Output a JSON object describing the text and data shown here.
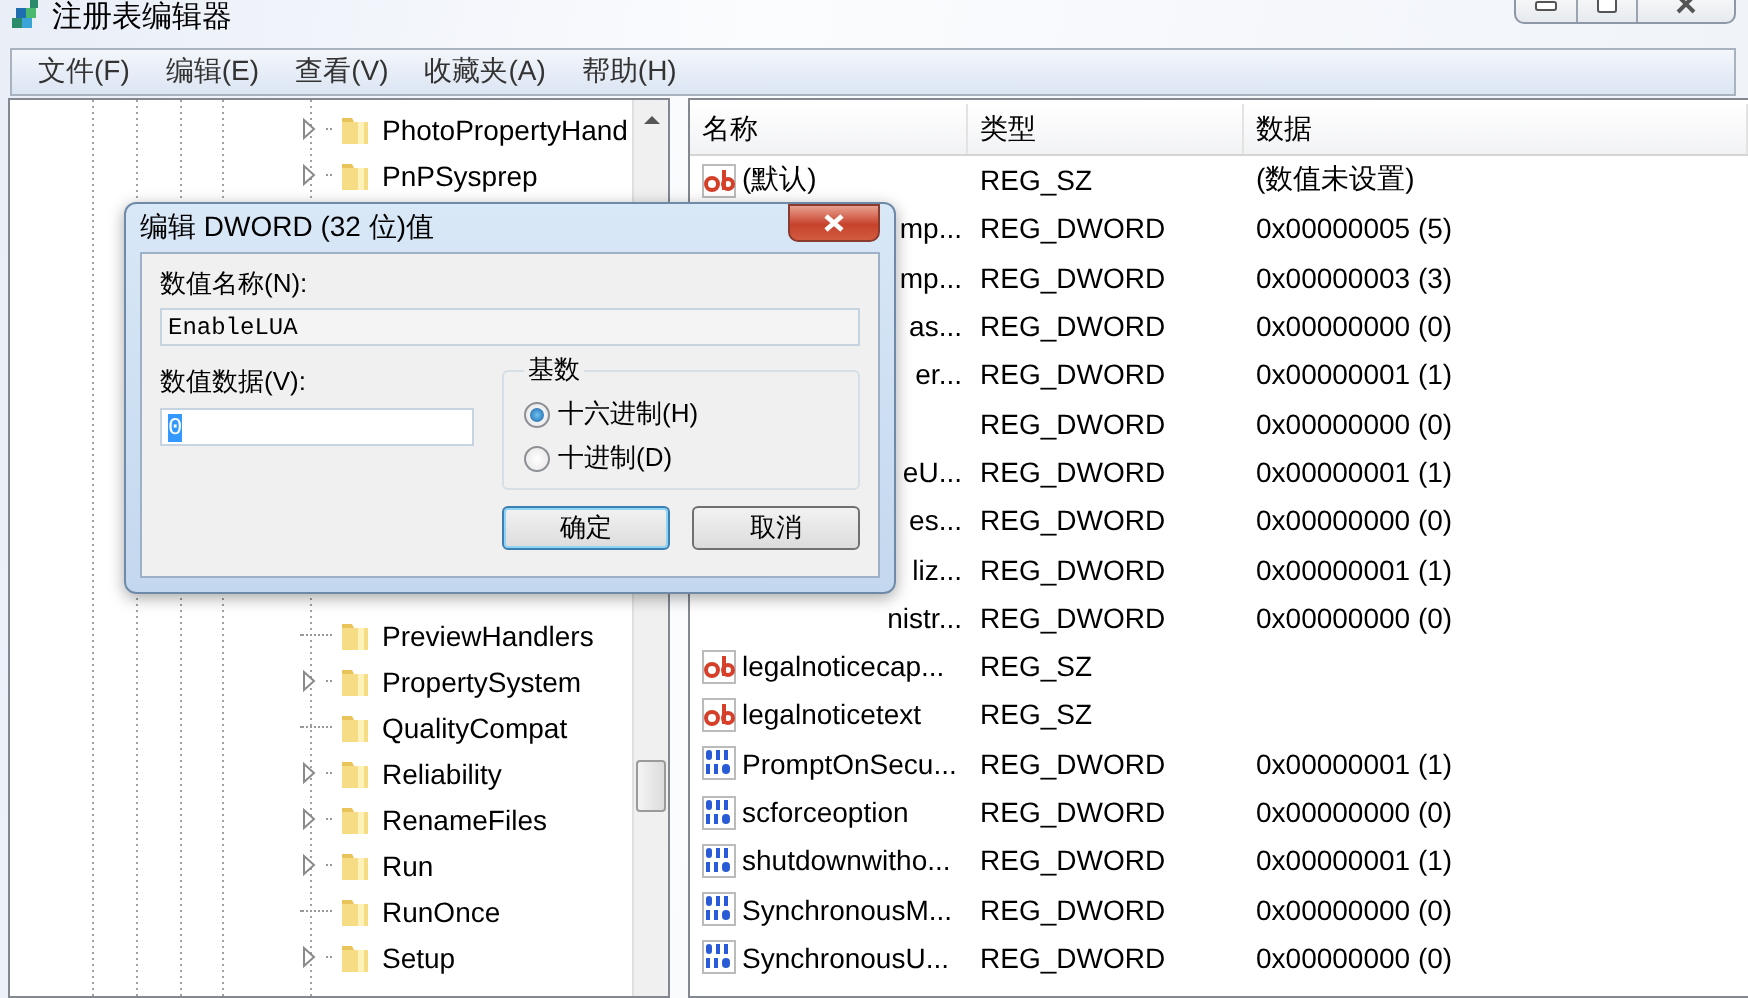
{
  "window": {
    "title": "注册表编辑器"
  },
  "menu": [
    "文件(F)",
    "编辑(E)",
    "查看(V)",
    "收藏夹(A)",
    "帮助(H)"
  ],
  "tree": {
    "top_items": [
      {
        "label": "PhotoPropertyHand",
        "expandable": true
      },
      {
        "label": "PnPSysprep",
        "expandable": true
      }
    ],
    "bottom_items": [
      {
        "label": "PreviewHandlers",
        "expandable": false
      },
      {
        "label": "PropertySystem",
        "expandable": true
      },
      {
        "label": "QualityCompat",
        "expandable": false
      },
      {
        "label": "Reliability",
        "expandable": true
      },
      {
        "label": "RenameFiles",
        "expandable": true
      },
      {
        "label": "Run",
        "expandable": true
      },
      {
        "label": "RunOnce",
        "expandable": false
      },
      {
        "label": "Setup",
        "expandable": true
      }
    ]
  },
  "list": {
    "columns": [
      "名称",
      "类型",
      "数据"
    ],
    "rows": [
      {
        "kind": "sz",
        "name": "(默认)",
        "type": "REG_SZ",
        "data": "(数值未设置)"
      },
      {
        "kind": "covered",
        "name": "mp...",
        "type": "REG_DWORD",
        "data": "0x00000005 (5)"
      },
      {
        "kind": "covered",
        "name": "mp...",
        "type": "REG_DWORD",
        "data": "0x00000003 (3)"
      },
      {
        "kind": "covered",
        "name": "as...",
        "type": "REG_DWORD",
        "data": "0x00000000 (0)"
      },
      {
        "kind": "covered",
        "name": "er...",
        "type": "REG_DWORD",
        "data": "0x00000001 (1)"
      },
      {
        "kind": "covered",
        "type": "REG_DWORD",
        "data": "0x00000000 (0)"
      },
      {
        "kind": "covered",
        "name": "eU...",
        "type": "REG_DWORD",
        "data": "0x00000001 (1)"
      },
      {
        "kind": "covered",
        "name": "es...",
        "type": "REG_DWORD",
        "data": "0x00000000 (0)"
      },
      {
        "kind": "covered",
        "name": "liz...",
        "type": "REG_DWORD",
        "data": "0x00000001 (1)"
      },
      {
        "kind": "covered",
        "name": "nistr...",
        "type": "REG_DWORD",
        "data": "0x00000000 (0)"
      },
      {
        "kind": "sz",
        "name": "legalnoticecap...",
        "type": "REG_SZ"
      },
      {
        "kind": "sz",
        "name": "legalnoticetext",
        "type": "REG_SZ"
      },
      {
        "kind": "dword",
        "name": "PromptOnSecu...",
        "type": "REG_DWORD",
        "data": "0x00000001 (1)"
      },
      {
        "kind": "dword",
        "name": "scforceoption",
        "type": "REG_DWORD",
        "data": "0x00000000 (0)"
      },
      {
        "kind": "dword",
        "name": "shutdownwitho...",
        "type": "REG_DWORD",
        "data": "0x00000001 (1)"
      },
      {
        "kind": "dword",
        "name": "SynchronousM...",
        "type": "REG_DWORD",
        "data": "0x00000000 (0)"
      },
      {
        "kind": "dword",
        "name": "SynchronousU...",
        "type": "REG_DWORD",
        "data": "0x00000000 (0)"
      }
    ]
  },
  "dialog": {
    "title": "编辑 DWORD (32 位)值",
    "name_label": "数值名称(N):",
    "name_value": "EnableLUA",
    "data_label": "数值数据(V):",
    "data_value": "0",
    "value_selected": true,
    "base": {
      "legend": "基数",
      "options": [
        {
          "label": "十六进制(H)",
          "selected": true
        },
        {
          "label": "十进制(D)",
          "selected": false
        }
      ]
    },
    "buttons": [
      {
        "label": "确定",
        "default": true
      },
      {
        "label": "取消",
        "default": false
      }
    ]
  }
}
